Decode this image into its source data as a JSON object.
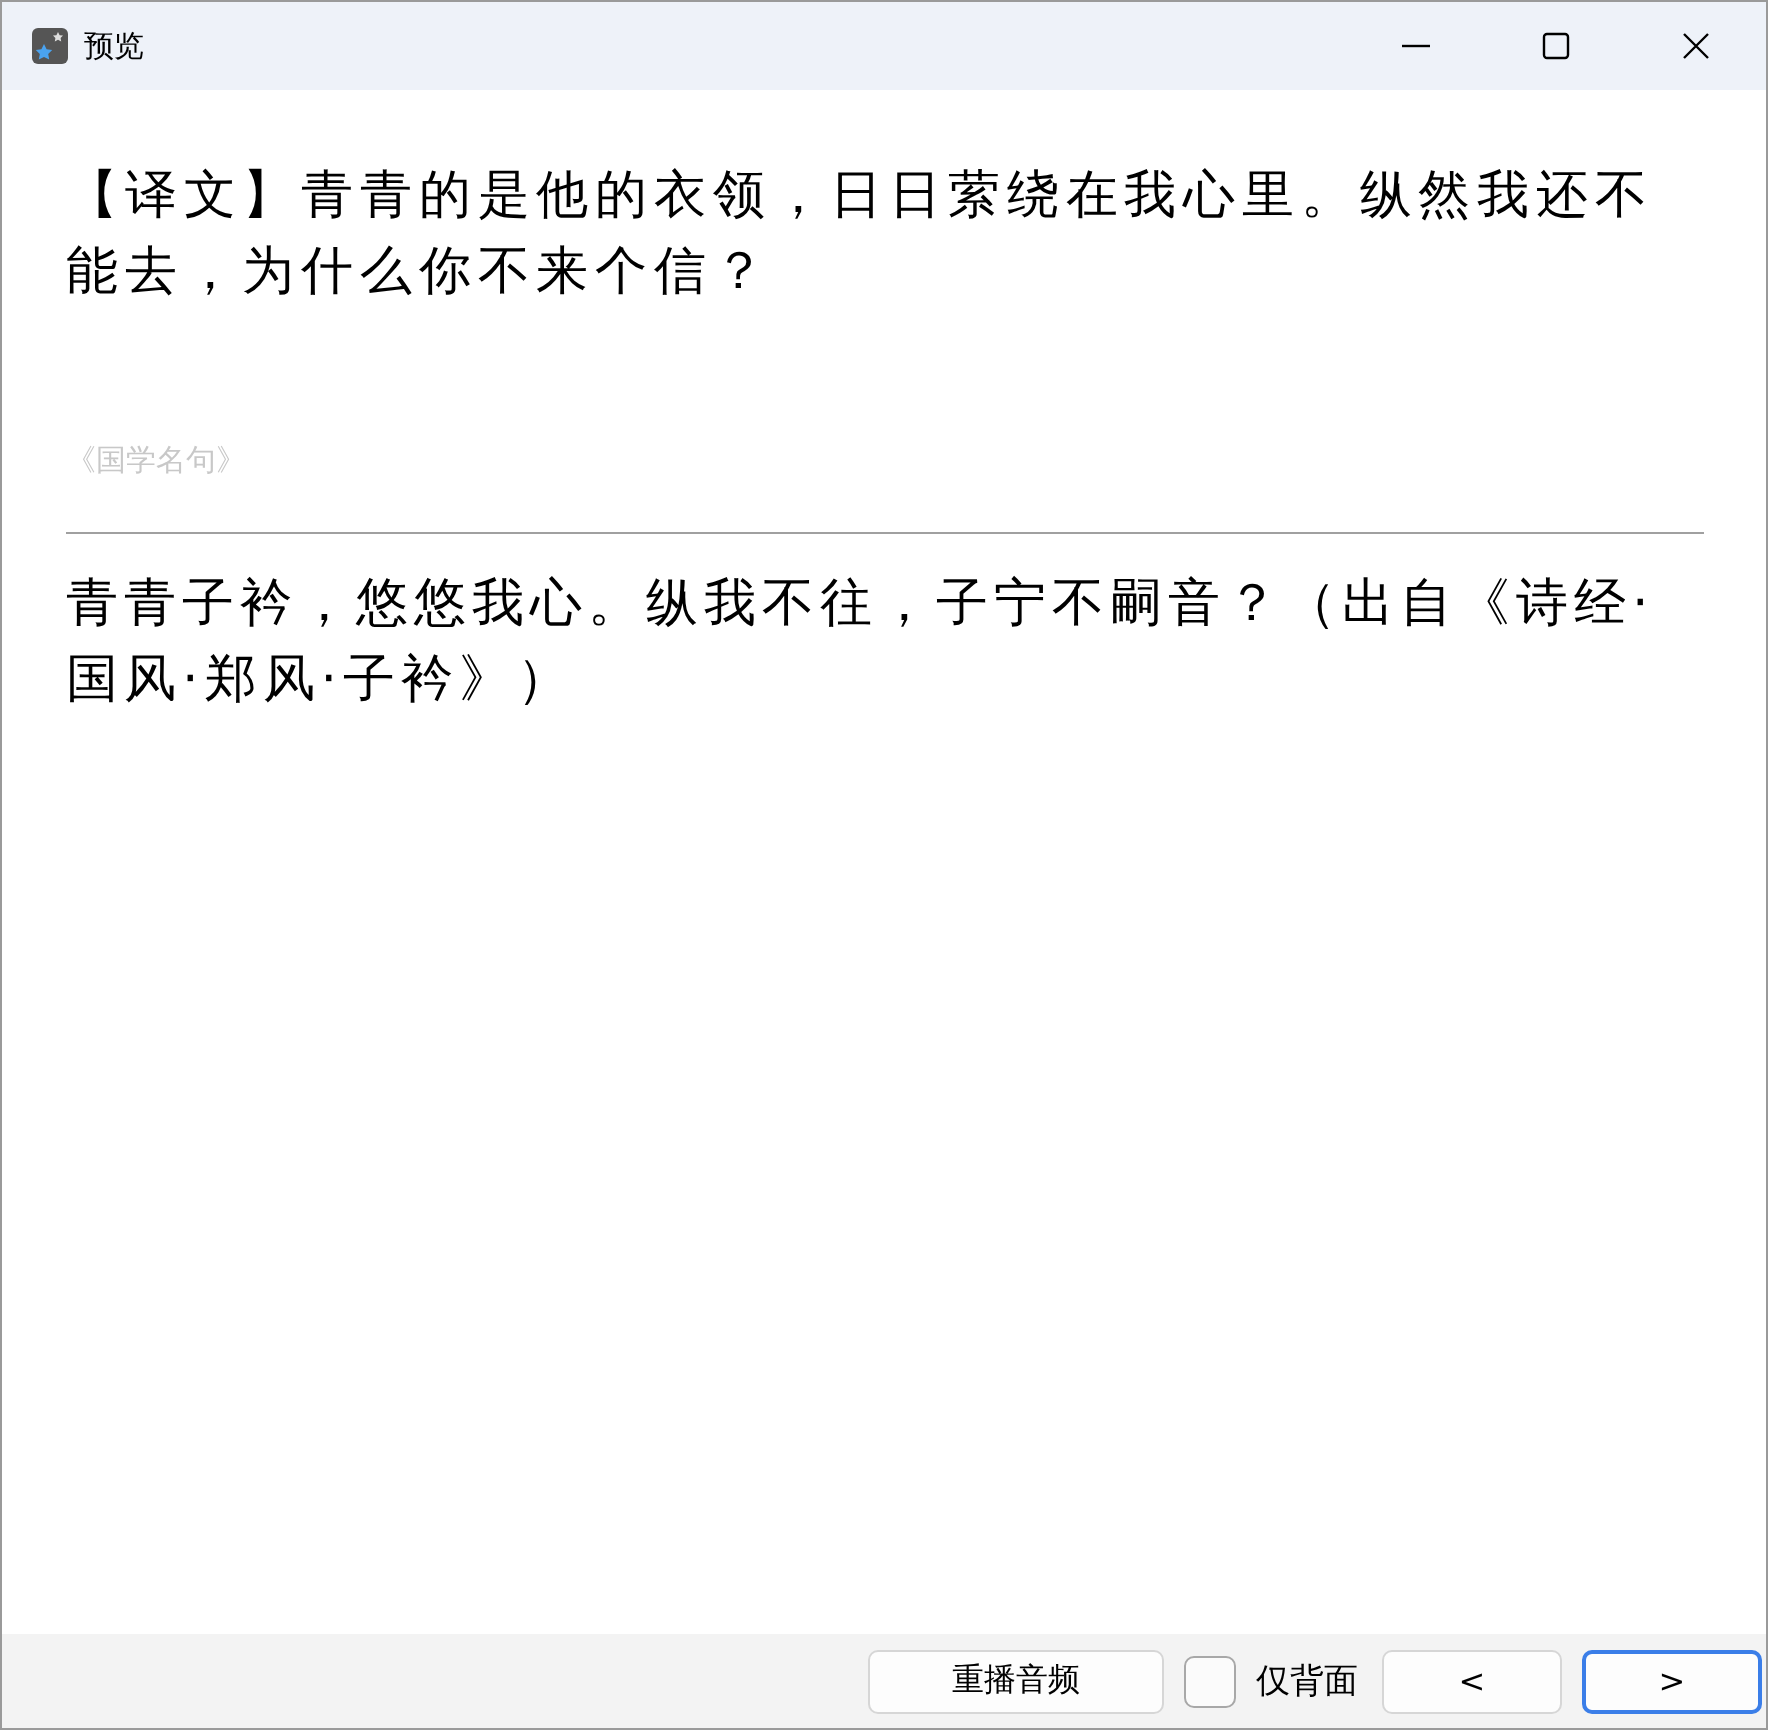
{
  "window": {
    "title": "预览"
  },
  "front": {
    "text": "【译文】青青的是他的衣领，日日萦绕在我心里。纵然我还不能去，为什么你不来个信？"
  },
  "source": "《国学名句》",
  "back": {
    "text": "青青子衿，悠悠我心。纵我不往，子宁不嗣音？（出自《诗经·国风·郑风·子衿》）"
  },
  "footer": {
    "replay": {
      "label": "重播音频",
      "focused": false
    },
    "back_only": {
      "label": "仅背面",
      "checked": false
    },
    "nav": [
      {
        "label": "<",
        "focused": false
      },
      {
        "label": ">",
        "focused": true
      }
    ]
  }
}
